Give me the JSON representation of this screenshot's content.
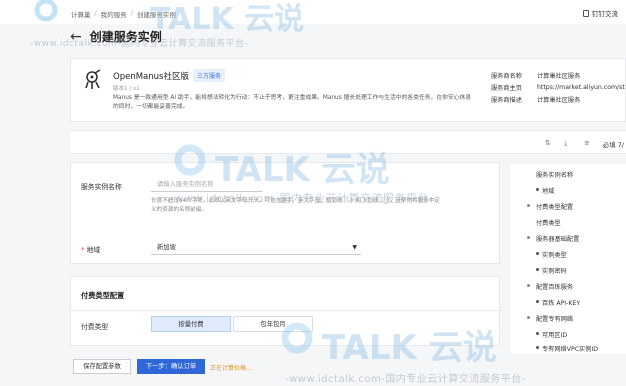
{
  "topbar": {
    "breadcrumb": [
      "计算巢",
      "我的服务",
      "创建服务实例"
    ],
    "pin_label": "钉钉交流"
  },
  "page": {
    "title": "创建服务实例"
  },
  "product": {
    "name": "OpenManus社区版",
    "tag": "三方服务",
    "version": "版本1 | v1",
    "description": "Manus 是一款通用型 AI 助手，能将想法转化为行动：不止于思考，更注重成果。Manus 擅长处理工作与生活中的各类任务，在你安心休息的同时，一切都能妥善完成。",
    "meta": [
      {
        "label": "服务商名称",
        "value": "计算巢社区服务"
      },
      {
        "label": "服务商主页",
        "value": "https://market.aliyun.com/store"
      },
      {
        "label": "服务商描述",
        "value": "计算巢社区服务"
      }
    ]
  },
  "toolbar": {
    "required_label": "必填 7/"
  },
  "form": {
    "instance_name_label": "服务实例名称",
    "instance_name_placeholder": "请输入服务实例名称",
    "instance_name_hint": "长度不超过64个字符，必须以英文字母开头，可包含数字、英文字母、短划线（-）和下划线（_），且帮你将服务中定义的资源的名称前缀。",
    "region_label": "地域",
    "region_value": "新加坡"
  },
  "payment": {
    "section_title": "付费类型配置",
    "type_label": "付费类型",
    "options": [
      "按量付费",
      "包年包月"
    ],
    "selected": "按量付费"
  },
  "side_nav": [
    {
      "label": "服务实例名称",
      "level": 0
    },
    {
      "label": "地域",
      "level": 1
    },
    {
      "label": "付费类型配置",
      "level": 0
    },
    {
      "label": "付费类型",
      "level": 1
    },
    {
      "label": "服务器基础配置",
      "level": 0
    },
    {
      "label": "实例类型",
      "level": 1
    },
    {
      "label": "实例密码",
      "level": 1
    },
    {
      "label": "配置百炼服务",
      "level": 0
    },
    {
      "label": "百炼 API-KEY",
      "level": 1
    },
    {
      "label": "配置专有网络",
      "level": 0
    },
    {
      "label": "可用区ID",
      "level": 1
    },
    {
      "label": "专有网络VPC实例ID",
      "level": 1
    }
  ],
  "footer": {
    "save_label": "保存配置参数",
    "next_label": "下一步：确认订单",
    "calc_label": "正在计算价格..."
  },
  "watermark": {
    "brand": "TALK 云说",
    "url": "-www.idctalk.com-国内专业云计算交流服务平台-"
  },
  "colors": {
    "primary": "#2f66d8",
    "tag_bg": "#e8f0fe",
    "calc": "#e8900d"
  }
}
